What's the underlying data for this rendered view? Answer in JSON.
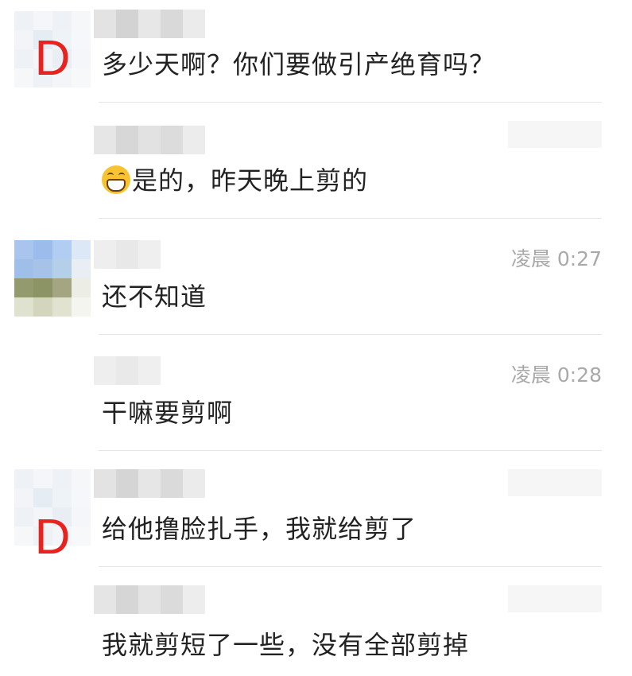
{
  "messages": [
    {
      "avatar_letter": "D",
      "text": "多少天啊？你们要做引产绝育吗？",
      "time": ""
    },
    {
      "avatar_letter": "",
      "text": "是的，昨天晚上剪的",
      "time": "",
      "emoji": "grinning-face-icon"
    },
    {
      "avatar_letter": "",
      "text": "还不知道",
      "time": "凌晨 0:27"
    },
    {
      "avatar_letter": "",
      "text": "干嘛要剪啊",
      "time": "凌晨 0:28"
    },
    {
      "avatar_letter": "D",
      "text": "给他撸脸扎手，我就给剪了",
      "time": ""
    },
    {
      "avatar_letter": "",
      "text": "我就剪短了一些，没有全部剪掉",
      "time": ""
    }
  ],
  "colors": {
    "avatar_letter": "#e8231f",
    "text": "#222222",
    "time": "#a9a9a9",
    "divider": "#e5e5e5"
  }
}
